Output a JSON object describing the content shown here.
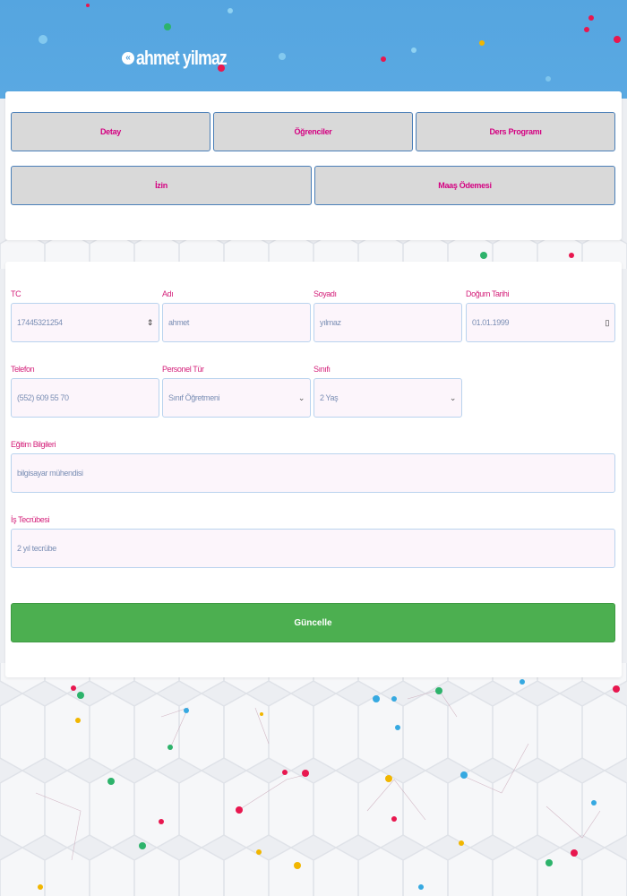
{
  "brand": {
    "name": "ahmet yilmaz",
    "icon": "double-chevron-left-icon"
  },
  "nav": {
    "row1": [
      "Detay",
      "Öğrenciler",
      "Ders Programı"
    ],
    "row2": [
      "İzin",
      "Maaş Ödemesi"
    ]
  },
  "form": {
    "tc": {
      "label": "TC",
      "value": "17445321254"
    },
    "adi": {
      "label": "Adı",
      "value": "ahmet"
    },
    "soyadi": {
      "label": "Soyadı",
      "value": "yılmaz"
    },
    "dogum": {
      "label": "Doğum Tarihi",
      "value": "01.01.1999"
    },
    "telefon": {
      "label": "Telefon",
      "value": "(552) 609 55 70"
    },
    "personel": {
      "label": "Personel Tür",
      "value": "Sınıf Öğretmeni"
    },
    "sinif": {
      "label": "Sınıfı",
      "value": "2 Yaş"
    },
    "egitim": {
      "label": "Eğitim Bilgileri",
      "value": "bilgisayar mühendisi"
    },
    "tecrube": {
      "label": "İş Tecrübesi",
      "value": "2 yıl tecrübe"
    },
    "submit_label": "Güncelle"
  },
  "colors": {
    "header": "#55a5e0",
    "accent_text": "#d40081",
    "submit": "#4caf50"
  }
}
